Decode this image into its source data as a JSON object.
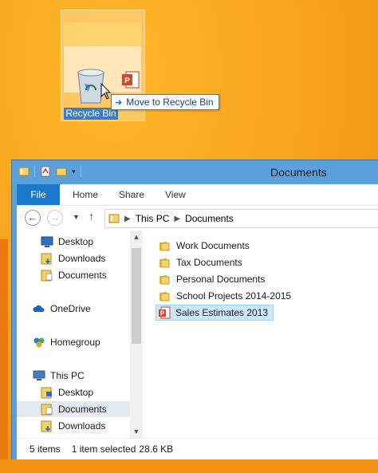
{
  "desktop": {
    "recycle_bin_label": "Recycle Bin",
    "tooltip": "Move to Recycle Bin"
  },
  "window": {
    "title": "Documents",
    "ribbon_tabs": [
      "File",
      "Home",
      "Share",
      "View"
    ],
    "breadcrumb": [
      "This PC",
      "Documents"
    ]
  },
  "nav": {
    "items": [
      {
        "label": "Desktop",
        "icon": "desktop-icon"
      },
      {
        "label": "Downloads",
        "icon": "downloads-folder-icon"
      },
      {
        "label": "Documents",
        "icon": "documents-folder-icon"
      },
      {
        "label": "OneDrive",
        "icon": "onedrive-cloud-icon"
      },
      {
        "label": "Homegroup",
        "icon": "homegroup-icon"
      },
      {
        "label": "This PC",
        "icon": "computer-icon"
      },
      {
        "label": "Desktop",
        "icon": "desktop-folder-icon"
      },
      {
        "label": "Documents",
        "icon": "documents-folder-icon",
        "selected": true
      },
      {
        "label": "Downloads",
        "icon": "downloads-folder-icon"
      }
    ]
  },
  "files": [
    {
      "name": "Work Documents",
      "icon": "folder-icon"
    },
    {
      "name": "Tax Documents",
      "icon": "folder-icon"
    },
    {
      "name": "Personal Documents",
      "icon": "folder-icon"
    },
    {
      "name": "School Projects 2014-2015",
      "icon": "folder-icon"
    },
    {
      "name": "Sales Estimates 2013",
      "icon": "powerpoint-file-icon",
      "selected": true
    }
  ],
  "status": {
    "items_count": "5 items",
    "selected": "1 item selected",
    "size": "28.6 KB"
  },
  "colors": {
    "desktop": "#f6a31a",
    "titlebar": "#5ba0dd",
    "file_tab": "#1979ca",
    "selection": "#cce8ff"
  }
}
